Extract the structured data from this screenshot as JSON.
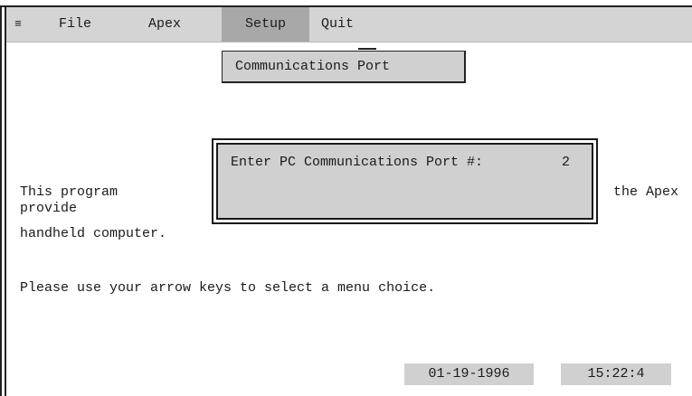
{
  "menubar": {
    "system_icon": "≡",
    "items": [
      "File",
      "Apex",
      "Setup",
      "Quit"
    ]
  },
  "dropdown": {
    "item": "Communications Port"
  },
  "dialog": {
    "prompt": "Enter PC Communications Port #:",
    "value": "2"
  },
  "body": {
    "line1_left": "This program",
    "line1_right": "the Apex",
    "line2": "provide",
    "line3": "handheld computer.",
    "instruction": "Please use your arrow keys to select a menu choice."
  },
  "status": {
    "date": "01-19-1996",
    "time": "15:22:4"
  },
  "colors": {
    "menubar": "#d4d4d4",
    "selected_menu": "#a8a8a8",
    "panel": "#d0d0d0",
    "text": "#1a1a1a"
  }
}
